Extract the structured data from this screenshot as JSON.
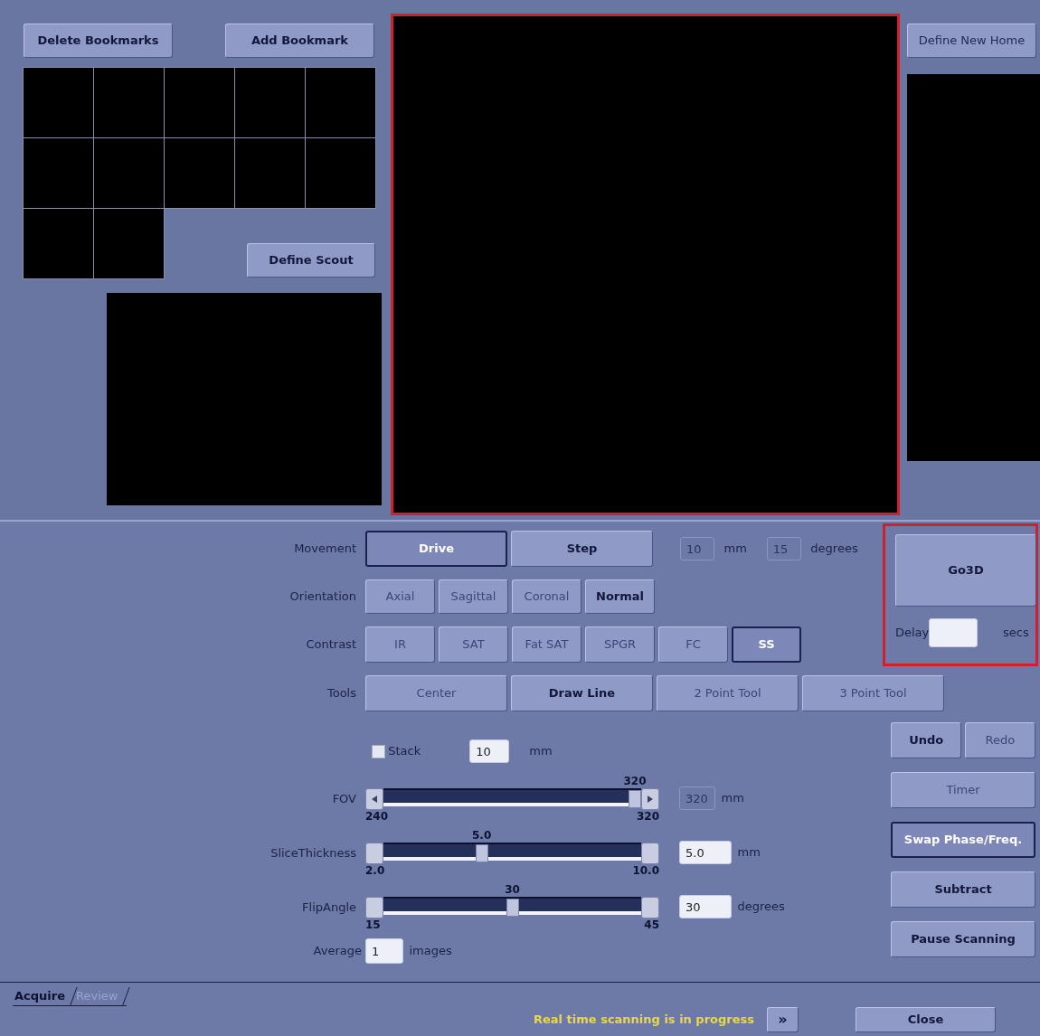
{
  "bookmarks": {
    "buttons": [
      {
        "label": "Delete Bookmarks"
      },
      {
        "label": "Add Bookmark"
      }
    ],
    "thumbnails": [
      {
        "kind": "empty"
      },
      {
        "kind": "empty"
      },
      {
        "kind": "empty"
      },
      {
        "kind": "empty"
      },
      {
        "kind": "empty"
      },
      {
        "kind": "empty"
      },
      {
        "kind": "empty"
      },
      {
        "kind": "empty"
      },
      {
        "kind": "empty"
      },
      {
        "kind": "empty"
      },
      {
        "kind": "empty"
      },
      {
        "kind": "empty"
      }
    ],
    "scout_button": {
      "label": "Define Scout"
    }
  },
  "viewer": {
    "highlighted": true
  },
  "home": {
    "button": {
      "label": "Define New Home"
    }
  },
  "button_rows": [
    {
      "label": "Movement",
      "kind": "wide",
      "options": [
        {
          "label": "Drive",
          "selected": true
        },
        {
          "label": "Step",
          "selected": false,
          "enabled": true
        }
      ],
      "fields": [
        {
          "value": "10",
          "unit": "mm",
          "disabled": true
        },
        {
          "value": "15",
          "unit": "degrees",
          "disabled": true
        }
      ]
    },
    {
      "label": "Orientation",
      "kind": "narrow",
      "options": [
        {
          "label": "Axial",
          "selected": false,
          "enabled": false
        },
        {
          "label": "Sagittal",
          "selected": false,
          "enabled": false
        },
        {
          "label": "Coronal",
          "selected": false,
          "enabled": false
        },
        {
          "label": "Normal",
          "selected": false,
          "enabled": true
        }
      ]
    },
    {
      "label": "Contrast",
      "kind": "narrow",
      "options": [
        {
          "label": "IR",
          "selected": false,
          "enabled": false
        },
        {
          "label": "SAT",
          "selected": false,
          "enabled": false
        },
        {
          "label": "Fat SAT",
          "selected": false,
          "enabled": false
        },
        {
          "label": "SPGR",
          "selected": false,
          "enabled": false
        },
        {
          "label": "FC",
          "selected": false,
          "enabled": false
        },
        {
          "label": "SS",
          "selected": true
        }
      ]
    },
    {
      "label": "Tools",
      "kind": "wide",
      "options": [
        {
          "label": "Center",
          "selected": false,
          "enabled": false
        },
        {
          "label": "Draw Line",
          "selected": false,
          "enabled": true
        },
        {
          "label": "2 Point Tool",
          "selected": false,
          "enabled": false
        },
        {
          "label": "3 Point Tool",
          "selected": false,
          "enabled": false
        }
      ]
    }
  ],
  "go3d": {
    "highlighted": true,
    "button": {
      "label": "Go3D"
    },
    "delay_label": "Delay",
    "unit": "secs"
  },
  "stack": {
    "label": "Stack",
    "checked": false,
    "value": "10",
    "unit": "mm"
  },
  "sliders": [
    {
      "label": "FOV",
      "value": "320",
      "min": "240",
      "max": "320",
      "level": 1,
      "end_arrows": true,
      "field": {
        "value": "320",
        "disabled": true
      },
      "unit": "mm"
    },
    {
      "label": "SliceThickness",
      "value": "5.0",
      "min": "2.0",
      "max": "10.0",
      "level": 0.375,
      "end_arrows": false,
      "field": {
        "value": "5.0",
        "disabled": false
      },
      "unit": "mm"
    },
    {
      "label": "FlipAngle",
      "value": "30",
      "min": "15",
      "max": "45",
      "level": 0.5,
      "end_arrows": false,
      "field": {
        "value": "30",
        "disabled": false
      },
      "unit": "degrees"
    }
  ],
  "averages": {
    "label": "Average",
    "value": "1",
    "unit": "images"
  },
  "side_buttons": [
    [
      {
        "label": "Undo",
        "selected": false,
        "enabled": true
      },
      {
        "label": "Redo",
        "selected": false,
        "enabled": false
      }
    ],
    [
      {
        "label": "Timer",
        "selected": false,
        "enabled": false
      }
    ],
    [
      {
        "label": "Swap Phase/Freq.",
        "selected": true
      }
    ],
    [
      {
        "label": "Subtract",
        "selected": false,
        "enabled": true
      }
    ],
    [
      {
        "label": "Pause Scanning",
        "selected": false,
        "enabled": true
      }
    ]
  ],
  "footer": {
    "tabs": [
      {
        "label": "Acquire",
        "selected": true
      },
      {
        "label": "Review",
        "selected": false
      }
    ],
    "status": "Real time scanning is in progress",
    "more_button": "»",
    "close_button": "Close"
  }
}
